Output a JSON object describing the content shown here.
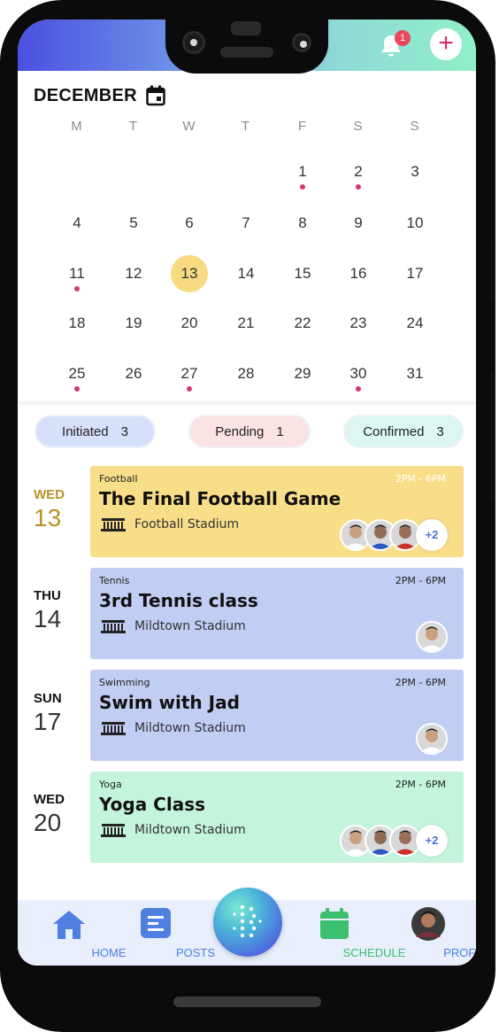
{
  "header": {
    "notification_count": "1",
    "add_label": "+"
  },
  "calendar": {
    "month": "DECEMBER",
    "weekdays": [
      "M",
      "T",
      "W",
      "T",
      "F",
      "S",
      "S"
    ],
    "rows": [
      [
        "",
        "",
        "",
        "",
        "1",
        "2",
        "3"
      ],
      [
        "4",
        "5",
        "6",
        "7",
        "8",
        "9",
        "10"
      ],
      [
        "11",
        "12",
        "13",
        "14",
        "15",
        "16",
        "17"
      ],
      [
        "18",
        "19",
        "20",
        "21",
        "22",
        "23",
        "24"
      ],
      [
        "25",
        "26",
        "27",
        "28",
        "29",
        "30",
        "31"
      ]
    ],
    "today": "13",
    "event_days": [
      "1",
      "2",
      "11",
      "25",
      "27",
      "30"
    ]
  },
  "status": [
    {
      "label": "Initiated",
      "count": "3"
    },
    {
      "label": "Pending",
      "count": "1"
    },
    {
      "label": "Confirmed",
      "count": "3"
    }
  ],
  "events": [
    {
      "dow": "WED",
      "day": "13",
      "category": "Football",
      "time": "2PM - 6PM",
      "title": "The Final Football Game",
      "venue": "Football Stadium",
      "more": "+2",
      "color": "#f9de8a",
      "active": true
    },
    {
      "dow": "THU",
      "day": "14",
      "category": "Tennis",
      "time": "2PM - 6PM",
      "title": "3rd Tennis class",
      "venue": "Mildtown Stadium",
      "more": "",
      "color": "#c2cdf4",
      "active": false
    },
    {
      "dow": "SUN",
      "day": "17",
      "category": "Swimming",
      "time": "2PM - 6PM",
      "title": "Swim with Jad",
      "venue": "Mildtown Stadium",
      "more": "",
      "color": "#c2cdf4",
      "active": false
    },
    {
      "dow": "WED",
      "day": "20",
      "category": "Yoga",
      "time": "2PM - 6PM",
      "title": "Yoga Class",
      "venue": "Mildtown Stadium",
      "more": "+2",
      "color": "#c4f5dc",
      "active": false
    }
  ],
  "nav": {
    "home": "HOME",
    "posts": "POSTS",
    "schedule": "SCHEDULE",
    "profile": "PROFILE"
  },
  "colors": {
    "accent_pink": "#d93668",
    "today_highlight": "#f7da82",
    "nav_blue": "#4f7fe0",
    "nav_green": "#3cbf6e"
  }
}
